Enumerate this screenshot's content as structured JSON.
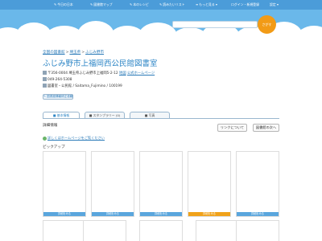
{
  "nav": {
    "items": [
      {
        "icon": "✎",
        "label": "今日の日本"
      },
      {
        "icon": "✎",
        "label": "図書館マップ"
      },
      {
        "icon": "✎",
        "label": "本のレシピ"
      },
      {
        "icon": "✎",
        "label": "読みたいリスト"
      },
      {
        "icon": "≡",
        "label": "もっと見る ▾"
      }
    ],
    "login_label": "ログイン・新規登録",
    "settings_label": "設定 ▾"
  },
  "search": {
    "placeholder": "",
    "button_label": "さがす"
  },
  "breadcrumb": [
    "全国の図書館",
    "埼玉県",
    "ふじみ野市"
  ],
  "title": "ふじみ野市上福岡西公民館図書室",
  "address": {
    "text": "〒356-0004 埼玉県ふじみ野市上福岡5-2-12",
    "map_link": "地図",
    "homepage_link": "公式ホームページ"
  },
  "phone": "049-264-5308",
  "library_type": "図書室・公民館 / Saitama_Fujimino / 100199",
  "report_button": "図書館情報修正依頼",
  "tabs": [
    {
      "label": "基本情報",
      "active": true
    },
    {
      "label": "スタンプラリー (0)",
      "active": false
    },
    {
      "label": "写真",
      "active": false
    }
  ],
  "detail_heading": "詳細情報",
  "link_about_button": "リンクについて",
  "prev_library_button": "図書館の次へ",
  "homepage_notice": "詳しくはホームページをご覧ください",
  "pickup_heading": "ピックアップ",
  "cards_row1": [
    {
      "label": "詳細をみる",
      "color": "#5aa6dd"
    },
    {
      "label": "詳細をみる",
      "color": "#5aa6dd"
    },
    {
      "label": "詳細をみる",
      "color": "#5aa6dd"
    },
    {
      "label": "詳細をみる",
      "color": "#f0a21a"
    },
    {
      "label": "詳細をみる",
      "color": "#5aa6dd"
    }
  ],
  "colors": {
    "nav_bg": "#4b9cd9",
    "sky": "#6ab8ea",
    "accent": "#2e86c6",
    "search_button": "#f29b16"
  }
}
